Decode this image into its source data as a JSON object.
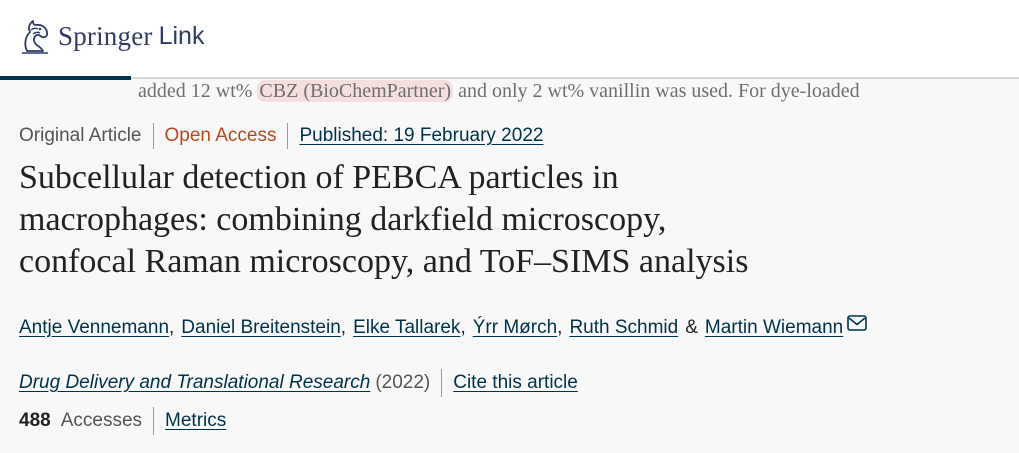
{
  "header": {
    "logo_brand": "Springer",
    "logo_sub": "Link",
    "logo_icon": "springer-horse-icon"
  },
  "snippet": {
    "before": "added 12 wt% ",
    "highlight": "CBZ (BioChemPartner)",
    "after": " and only 2 wt% vanillin was used. For dye-loaded"
  },
  "meta": {
    "article_type": "Original Article",
    "access": "Open Access",
    "published": "Published: 19 February 2022"
  },
  "article": {
    "title_lines": [
      "Subcellular detection of PEBCA particles in",
      "macrophages: combining darkfield microscopy,",
      "confocal Raman microscopy, and ToF–SIMS analysis"
    ]
  },
  "authors": [
    "Antje Vennemann",
    "Daniel Breitenstein",
    "Elke Tallarek",
    "Ýrr Mørch",
    "Ruth Schmid",
    "Martin Wiemann"
  ],
  "author_separator": ",",
  "author_last_joiner": "&",
  "journal": {
    "name": "Drug Delivery and Translational Research",
    "year": "(2022)",
    "cite_label": "Cite this article"
  },
  "stats": {
    "accesses_count": "488",
    "accesses_label": "Accesses",
    "metrics_label": "Metrics"
  },
  "colors": {
    "link": "#01324b",
    "open_access": "#b54a20",
    "highlight_bg": "#f4dede"
  }
}
